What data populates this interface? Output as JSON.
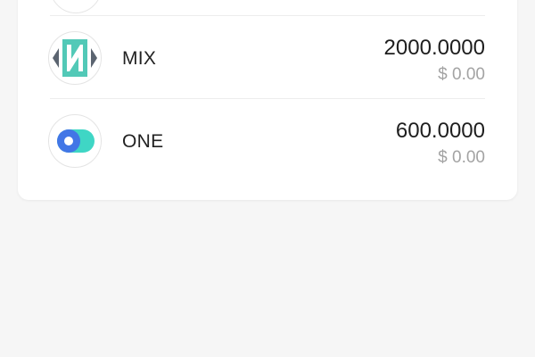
{
  "tokens": [
    {
      "symbol": "MIX",
      "amount": "2000.0000",
      "fiat": "$ 0.00",
      "icon": "mix-logo-icon",
      "colors": {
        "primary": "#52c9b7",
        "secondary": "#5b6470"
      }
    },
    {
      "symbol": "ONE",
      "amount": "600.0000",
      "fiat": "$ 0.00",
      "icon": "harmony-one-logo-icon",
      "colors": {
        "primary": "#4276e6",
        "secondary": "#3fd6c5"
      }
    }
  ],
  "colors": {
    "background": "#f6f6f6",
    "card": "#ffffff",
    "text_primary": "#1e1e1e",
    "text_secondary": "#a3a3a3"
  }
}
